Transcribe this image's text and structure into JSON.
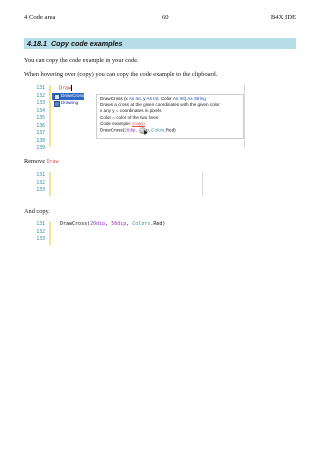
{
  "header": {
    "left": "4  Code area",
    "center": "60",
    "right": "B4X   IDE"
  },
  "section": {
    "number": "4.18.1",
    "title": "Copy code examples"
  },
  "paragraphs": {
    "p1": "You can copy the code example in your code.",
    "p2": "When hovering over (copy) you can copy the code example to the clipboard.",
    "p3_prefix": "Remove ",
    "p3_code": "Draw",
    "p4": "And copy."
  },
  "block1": {
    "line_numbers": [
      "131",
      "132",
      "133",
      "134",
      "135",
      "136",
      "137",
      "138",
      "139"
    ],
    "typed": "Draw",
    "autocomplete": {
      "items": [
        "DrawCross",
        "Drawing"
      ],
      "selected_index": 0
    },
    "tooltip": {
      "sig_name": "DrawCross",
      "sig_p1": "x",
      "sig_as1": "As",
      "sig_t1": "Int",
      "sig_p2": "y",
      "sig_as2": "As",
      "sig_t2": "Int",
      "sig_p3": "Color",
      "sig_as3": "As",
      "sig_t3": "Int",
      "sig_as4": "As",
      "sig_t4": "String",
      "line2": "Draws a cross at the given coordinates with the given color",
      "line3": "x any y = coordinates in pixels",
      "line4": "Color = color of the two lines",
      "example_label": "Code example: ",
      "example_copy": "(copy)",
      "example_code_a": "DrawCross(",
      "example_code_b": "20dip",
      "example_code_c": ", ",
      "example_code_d": "p, ",
      "example_code_e": "Colors",
      "example_code_f": ".Red)"
    }
  },
  "block2": {
    "line_numbers": [
      "131",
      "132",
      "133"
    ]
  },
  "block3": {
    "line_numbers": [
      "131",
      "132",
      "133"
    ],
    "code_a": "DrawCross(",
    "code_b": "20dip",
    "code_c": ", ",
    "code_d": "50dip",
    "code_e": ", ",
    "code_f": "Colors",
    "code_g": ".Red)"
  },
  "colors": {
    "section_bar": "#b7dde8",
    "line_number": "#2a8fa8",
    "gutter": "#f4e48a",
    "selection": "#2f68c6",
    "keyword_blue": "#1a46c8",
    "number_purple": "#9b30c8",
    "typed_red": "#c0392b"
  }
}
